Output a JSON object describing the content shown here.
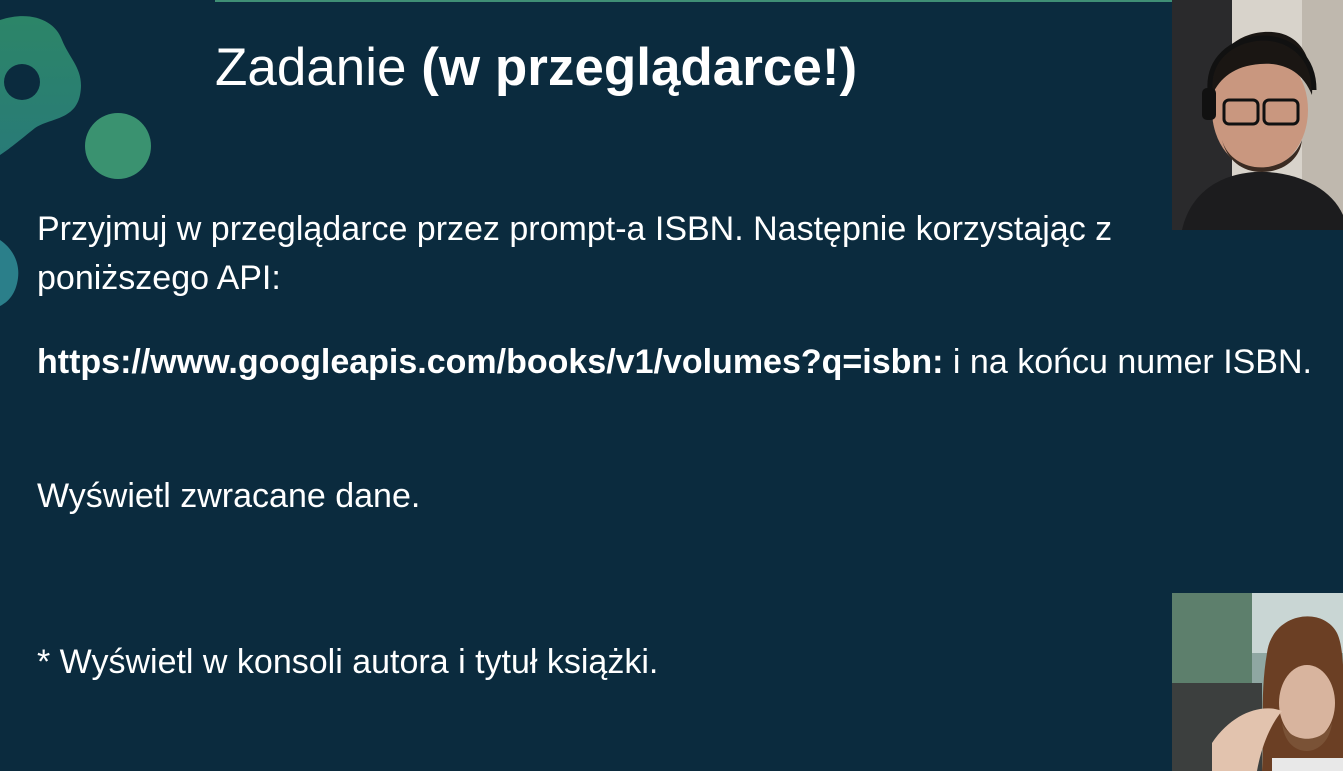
{
  "slide": {
    "title_regular": "Zadanie",
    "title_bold": "(w przeglądarce!)",
    "paragraph_1": "Przyjmuj w przeglądarce przez prompt-a ISBN. Następnie korzystając z poniższego API:",
    "api_url": "https://www.googleapis.com/books/v1/volumes?q=isbn:",
    "api_suffix": " i na końcu numer ISBN.",
    "paragraph_3": "Wyświetl zwracane dane.",
    "paragraph_4": "* Wyświetl w konsoli autora i tytuł książki."
  },
  "colors": {
    "background": "#0b2b3e",
    "accent_green": "#3f8f75",
    "text": "#ffffff"
  }
}
